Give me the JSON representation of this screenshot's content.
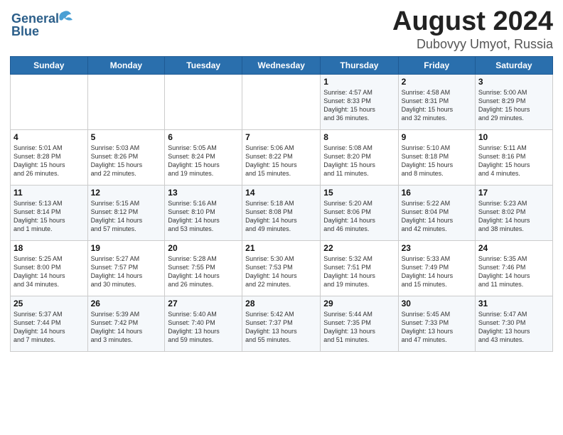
{
  "logo": {
    "line1": "General",
    "line2": "Blue"
  },
  "title": "August 2024",
  "subtitle": "Dubovyy Umyot, Russia",
  "days_of_week": [
    "Sunday",
    "Monday",
    "Tuesday",
    "Wednesday",
    "Thursday",
    "Friday",
    "Saturday"
  ],
  "weeks": [
    [
      {
        "day": "",
        "content": ""
      },
      {
        "day": "",
        "content": ""
      },
      {
        "day": "",
        "content": ""
      },
      {
        "day": "",
        "content": ""
      },
      {
        "day": "1",
        "content": "Sunrise: 4:57 AM\nSunset: 8:33 PM\nDaylight: 15 hours\nand 36 minutes."
      },
      {
        "day": "2",
        "content": "Sunrise: 4:58 AM\nSunset: 8:31 PM\nDaylight: 15 hours\nand 32 minutes."
      },
      {
        "day": "3",
        "content": "Sunrise: 5:00 AM\nSunset: 8:29 PM\nDaylight: 15 hours\nand 29 minutes."
      }
    ],
    [
      {
        "day": "4",
        "content": "Sunrise: 5:01 AM\nSunset: 8:28 PM\nDaylight: 15 hours\nand 26 minutes."
      },
      {
        "day": "5",
        "content": "Sunrise: 5:03 AM\nSunset: 8:26 PM\nDaylight: 15 hours\nand 22 minutes."
      },
      {
        "day": "6",
        "content": "Sunrise: 5:05 AM\nSunset: 8:24 PM\nDaylight: 15 hours\nand 19 minutes."
      },
      {
        "day": "7",
        "content": "Sunrise: 5:06 AM\nSunset: 8:22 PM\nDaylight: 15 hours\nand 15 minutes."
      },
      {
        "day": "8",
        "content": "Sunrise: 5:08 AM\nSunset: 8:20 PM\nDaylight: 15 hours\nand 11 minutes."
      },
      {
        "day": "9",
        "content": "Sunrise: 5:10 AM\nSunset: 8:18 PM\nDaylight: 15 hours\nand 8 minutes."
      },
      {
        "day": "10",
        "content": "Sunrise: 5:11 AM\nSunset: 8:16 PM\nDaylight: 15 hours\nand 4 minutes."
      }
    ],
    [
      {
        "day": "11",
        "content": "Sunrise: 5:13 AM\nSunset: 8:14 PM\nDaylight: 15 hours\nand 1 minute."
      },
      {
        "day": "12",
        "content": "Sunrise: 5:15 AM\nSunset: 8:12 PM\nDaylight: 14 hours\nand 57 minutes."
      },
      {
        "day": "13",
        "content": "Sunrise: 5:16 AM\nSunset: 8:10 PM\nDaylight: 14 hours\nand 53 minutes."
      },
      {
        "day": "14",
        "content": "Sunrise: 5:18 AM\nSunset: 8:08 PM\nDaylight: 14 hours\nand 49 minutes."
      },
      {
        "day": "15",
        "content": "Sunrise: 5:20 AM\nSunset: 8:06 PM\nDaylight: 14 hours\nand 46 minutes."
      },
      {
        "day": "16",
        "content": "Sunrise: 5:22 AM\nSunset: 8:04 PM\nDaylight: 14 hours\nand 42 minutes."
      },
      {
        "day": "17",
        "content": "Sunrise: 5:23 AM\nSunset: 8:02 PM\nDaylight: 14 hours\nand 38 minutes."
      }
    ],
    [
      {
        "day": "18",
        "content": "Sunrise: 5:25 AM\nSunset: 8:00 PM\nDaylight: 14 hours\nand 34 minutes."
      },
      {
        "day": "19",
        "content": "Sunrise: 5:27 AM\nSunset: 7:57 PM\nDaylight: 14 hours\nand 30 minutes."
      },
      {
        "day": "20",
        "content": "Sunrise: 5:28 AM\nSunset: 7:55 PM\nDaylight: 14 hours\nand 26 minutes."
      },
      {
        "day": "21",
        "content": "Sunrise: 5:30 AM\nSunset: 7:53 PM\nDaylight: 14 hours\nand 22 minutes."
      },
      {
        "day": "22",
        "content": "Sunrise: 5:32 AM\nSunset: 7:51 PM\nDaylight: 14 hours\nand 19 minutes."
      },
      {
        "day": "23",
        "content": "Sunrise: 5:33 AM\nSunset: 7:49 PM\nDaylight: 14 hours\nand 15 minutes."
      },
      {
        "day": "24",
        "content": "Sunrise: 5:35 AM\nSunset: 7:46 PM\nDaylight: 14 hours\nand 11 minutes."
      }
    ],
    [
      {
        "day": "25",
        "content": "Sunrise: 5:37 AM\nSunset: 7:44 PM\nDaylight: 14 hours\nand 7 minutes."
      },
      {
        "day": "26",
        "content": "Sunrise: 5:39 AM\nSunset: 7:42 PM\nDaylight: 14 hours\nand 3 minutes."
      },
      {
        "day": "27",
        "content": "Sunrise: 5:40 AM\nSunset: 7:40 PM\nDaylight: 13 hours\nand 59 minutes."
      },
      {
        "day": "28",
        "content": "Sunrise: 5:42 AM\nSunset: 7:37 PM\nDaylight: 13 hours\nand 55 minutes."
      },
      {
        "day": "29",
        "content": "Sunrise: 5:44 AM\nSunset: 7:35 PM\nDaylight: 13 hours\nand 51 minutes."
      },
      {
        "day": "30",
        "content": "Sunrise: 5:45 AM\nSunset: 7:33 PM\nDaylight: 13 hours\nand 47 minutes."
      },
      {
        "day": "31",
        "content": "Sunrise: 5:47 AM\nSunset: 7:30 PM\nDaylight: 13 hours\nand 43 minutes."
      }
    ]
  ]
}
